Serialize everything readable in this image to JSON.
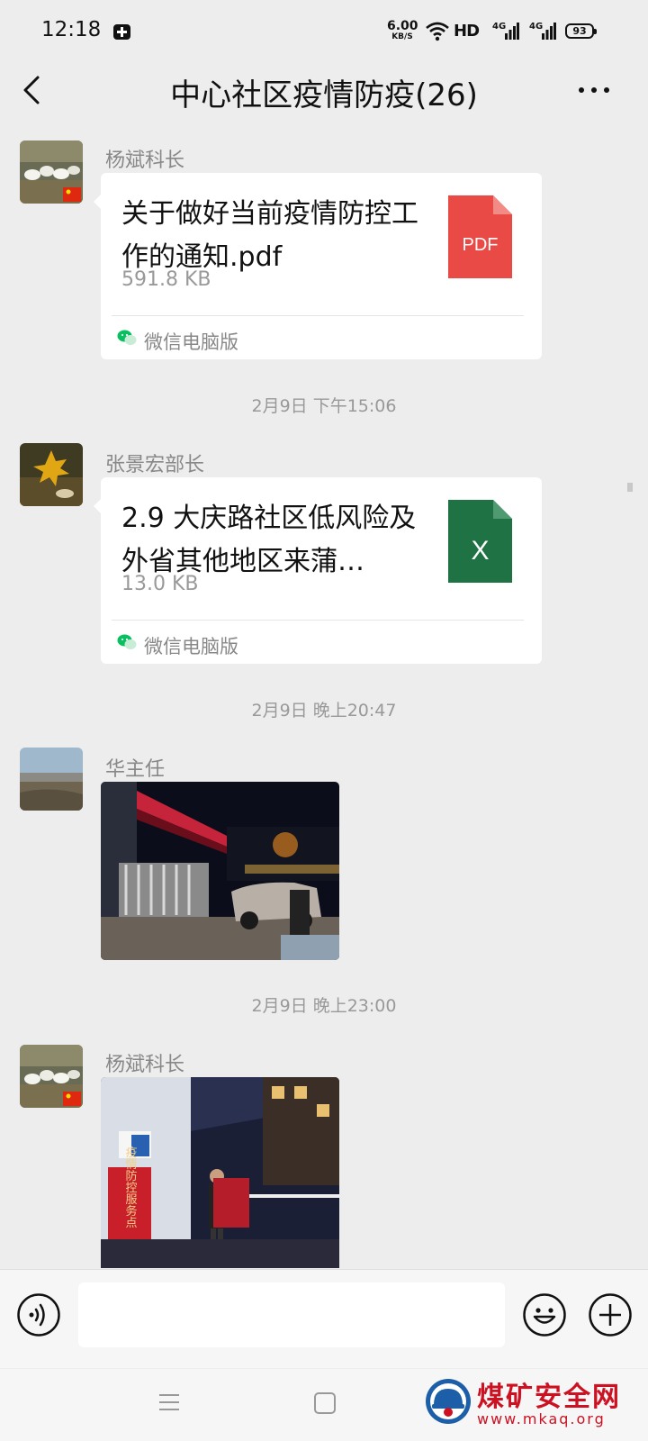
{
  "status_bar": {
    "time": "12:18",
    "net_speed_value": "6.00",
    "net_speed_unit": "KB/S",
    "hd_label": "HD",
    "signal1_label": "4G",
    "signal2_label": "4G",
    "battery": "93"
  },
  "header": {
    "title": "中心社区疫情防疫(26)"
  },
  "messages": [
    {
      "sender": "杨斌科长",
      "file_name": "关于做好当前疫情防控工作的通知.pdf",
      "file_size": "591.8 KB",
      "file_type_label": "PDF",
      "file_icon_color": "#e94a45",
      "source": "微信电脑版"
    },
    {
      "timestamp": "2月9日 下午15:06"
    },
    {
      "sender": "张景宏部长",
      "file_name": "2.9 大庆路社区低风险及外省其他地区来蒲…",
      "file_size": "13.0 KB",
      "file_type_label": "X",
      "file_icon_color": "#1f7244",
      "source": "微信电脑版"
    },
    {
      "timestamp": "2月9日 晚上20:47"
    },
    {
      "sender": "华主任",
      "image": "night-gate-photo"
    },
    {
      "timestamp": "2月9日 晚上23:00"
    },
    {
      "sender": "杨斌科长",
      "image": "checkpoint-photo",
      "sign_text": "疫情防控服务点"
    }
  ],
  "input_bar": {
    "text_value": "",
    "icons": [
      "voice-icon",
      "emoji-icon",
      "plus-icon"
    ]
  },
  "nav_bar": {
    "icons": [
      "menu-icon",
      "home-icon"
    ]
  },
  "watermark": {
    "title": "煤矿安全网",
    "url": "www.mkaq.org",
    "color": "#cc1122"
  },
  "colors": {
    "background": "#ededed",
    "bubble": "#ffffff",
    "wechat_green": "#07c160"
  }
}
